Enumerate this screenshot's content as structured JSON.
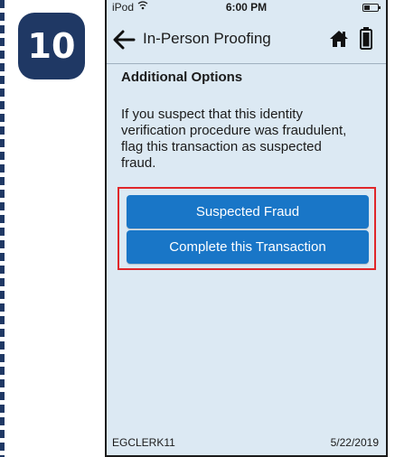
{
  "step_badge": "10",
  "status_bar": {
    "carrier": "iPod",
    "time": "6:00 PM"
  },
  "nav": {
    "title": "In-Person Proofing"
  },
  "content": {
    "section_title": "Additional Options",
    "instructions": "If you suspect that this identity verification procedure was fraudulent, flag this transaction as suspected fraud."
  },
  "buttons": {
    "suspected_fraud": "Suspected Fraud",
    "complete": "Complete this Transaction"
  },
  "footer": {
    "user": "EGCLERK11",
    "date": "5/22/2019"
  },
  "colors": {
    "badge": "#1f3864",
    "screen_bg": "#dce9f3",
    "button": "#1976c7",
    "highlight_border": "#e0262a"
  },
  "icons": [
    "back-arrow-icon",
    "home-icon",
    "battery-icon",
    "wifi-icon"
  ]
}
